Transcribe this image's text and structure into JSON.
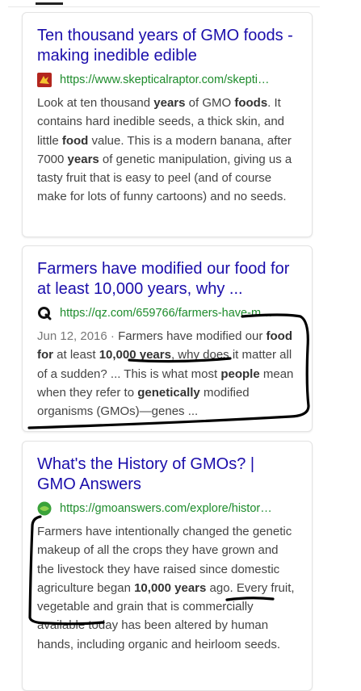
{
  "results": [
    {
      "title": "Ten thousand years of GMO foods - making inedible edible",
      "url": "https://www.skepticalraptor.com/skepti…",
      "favicon": "skeptical-raptor-logo",
      "snippet": [
        {
          "t": "Look at ten thousand "
        },
        {
          "t": "years",
          "b": true
        },
        {
          "t": " of GMO "
        },
        {
          "t": "foods",
          "b": true
        },
        {
          "t": ". It contains hard inedible seeds, a thick skin, and little "
        },
        {
          "t": "food",
          "b": true
        },
        {
          "t": " value. This is a modern banana, after 7000 "
        },
        {
          "t": "years",
          "b": true
        },
        {
          "t": " of genetic manipulation, giving us a tasty fruit that is easy to peel (and of course make for lots of funny cartoons) and no seeds."
        }
      ]
    },
    {
      "title": "Farmers have modified our food for at least 10,000 years, why ...",
      "url": "https://qz.com/659766/farmers-have-m…",
      "favicon": "quartz-q-logo",
      "date": "Jun 12, 2016",
      "snippet": [
        {
          "t": "Farmers have modified our "
        },
        {
          "t": "food for",
          "b": true
        },
        {
          "t": " at least "
        },
        {
          "t": "10,000 years",
          "b": true
        },
        {
          "t": ", why does it matter all of a sudden? ... This is what most "
        },
        {
          "t": "people",
          "b": true
        },
        {
          "t": " mean when they refer to "
        },
        {
          "t": "genetically",
          "b": true
        },
        {
          "t": " modified organisms (GMOs)—genes ..."
        }
      ]
    },
    {
      "title": "What's the History of GMOs? | GMO Answers",
      "url": "https://gmoanswers.com/explore/histor…",
      "favicon": "gmo-answers-logo",
      "snippet": [
        {
          "t": "Farmers have intentionally changed the genetic makeup of all the crops they have grown and the livestock they have raised since domestic agriculture began "
        },
        {
          "t": "10,000 years",
          "b": true
        },
        {
          "t": " ago. Every fruit, vegetable and grain that is commercially available today has been altered by human hands, including organic and heirloom seeds."
        }
      ]
    }
  ],
  "colors": {
    "title": "#1a0dab",
    "url": "#1e8c2c",
    "snippet": "#444444",
    "ink": "#000000"
  }
}
